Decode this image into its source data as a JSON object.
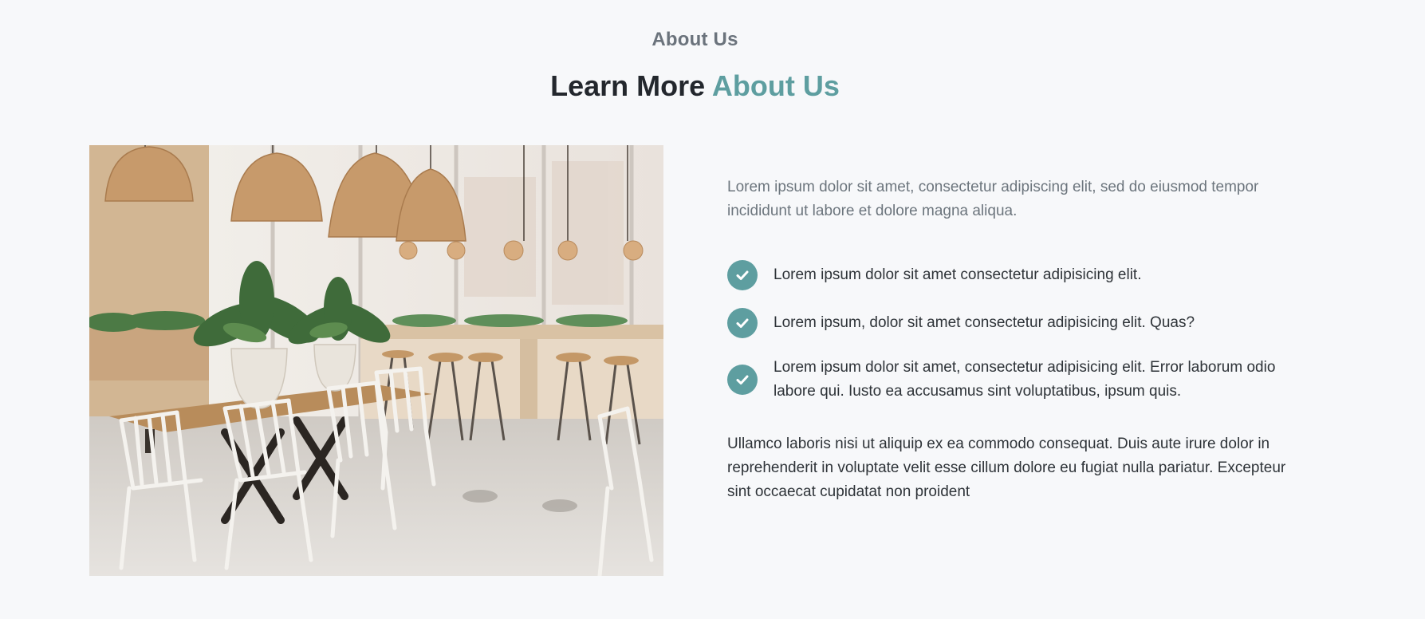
{
  "section": {
    "eyebrow": "About Us",
    "title_main": "Learn More",
    "title_accent": "About Us",
    "accent_color": "#5e9ea0"
  },
  "image": {
    "subject": "cafe interior with rattan pendant lamps, wooden tables and white chairs"
  },
  "content": {
    "intro": "Lorem ipsum dolor sit amet, consectetur adipiscing elit, sed do eiusmod tempor incididunt ut labore et dolore magna aliqua.",
    "features": [
      {
        "icon": "check-circle-icon",
        "text": "Lorem ipsum dolor sit amet consectetur adipisicing elit."
      },
      {
        "icon": "check-circle-icon",
        "text": "Lorem ipsum, dolor sit amet consectetur adipisicing elit. Quas?"
      },
      {
        "icon": "check-circle-icon",
        "text": "Lorem ipsum dolor sit amet, consectetur adipisicing elit. Error laborum odio labore qui. Iusto ea accusamus sint voluptatibus, ipsum quis."
      }
    ],
    "outro": "Ullamco laboris nisi ut aliquip ex ea commodo consequat. Duis aute irure dolor in reprehenderit in voluptate velit esse cillum dolore eu fugiat nulla pariatur. Excepteur sint occaecat cupidatat non proident"
  }
}
